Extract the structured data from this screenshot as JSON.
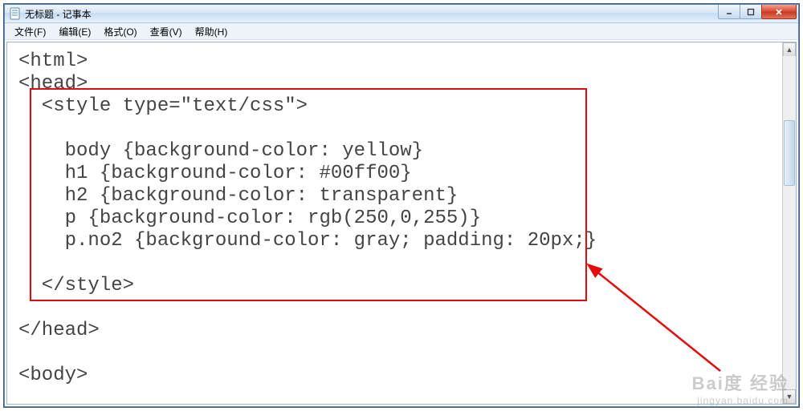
{
  "window": {
    "title": "无标题 - 记事本"
  },
  "menu": {
    "file": "文件(F)",
    "edit": "编辑(E)",
    "format": "格式(O)",
    "view": "查看(V)",
    "help": "帮助(H)"
  },
  "editor": {
    "lines": [
      "<html>",
      "<head>",
      "  <style type=\"text/css\">",
      "",
      "    body {background-color: yellow}",
      "    h1 {background-color: #00ff00}",
      "    h2 {background-color: transparent}",
      "    p {background-color: rgb(250,0,255)}",
      "    p.no2 {background-color: gray; padding: 20px;}",
      "",
      "  </style>",
      "",
      "</head>",
      "",
      "<body>"
    ]
  },
  "watermark": {
    "top": "Bai度 经验",
    "bottom": "jingyan.baidu.com"
  }
}
